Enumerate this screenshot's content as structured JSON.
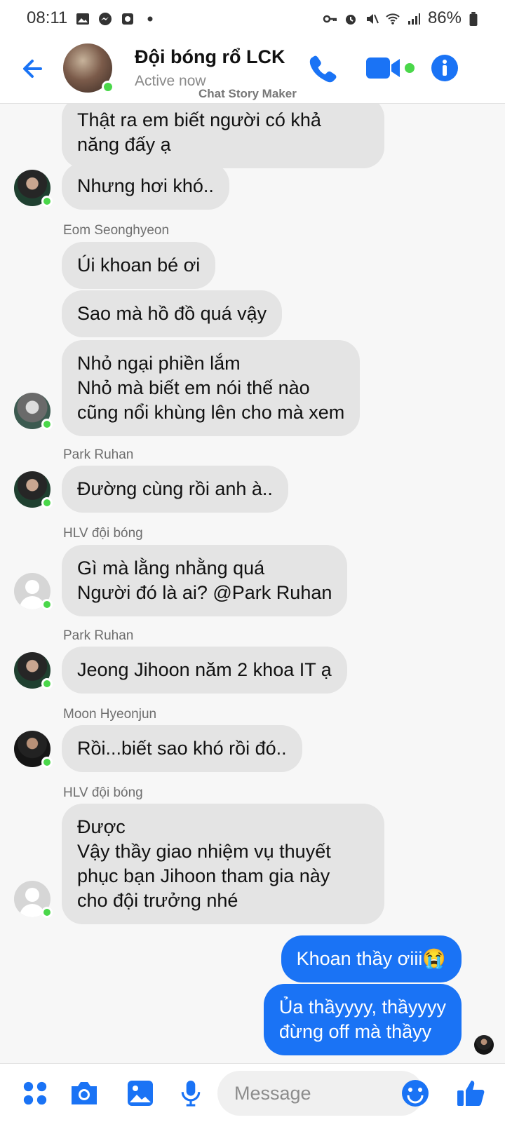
{
  "status_bar": {
    "time": "08:11",
    "battery": "86%"
  },
  "header": {
    "title": "Đội bóng rổ LCK",
    "subtitle": "Active now",
    "watermark": "Chat Story Maker"
  },
  "messages": [
    {
      "text": "Thật ra em biết người có khả\nnăng đấy ạ"
    },
    {
      "text": "Nhưng hơi khó.."
    },
    {
      "sender": "Eom Seonghyeon"
    },
    {
      "text": "Úi khoan bé ơi"
    },
    {
      "text": "Sao mà hồ đồ quá vậy"
    },
    {
      "text": "Nhỏ ngại phiền lắm\nNhỏ mà biết em nói thế nào\ncũng nổi khùng lên cho mà xem"
    },
    {
      "sender": "Park Ruhan"
    },
    {
      "text": "Đường cùng rồi anh à.."
    },
    {
      "sender": "HLV đội bóng"
    },
    {
      "text": "Gì mà lằng nhằng quá\nNgười đó là ai? @Park Ruhan"
    },
    {
      "sender": "Park Ruhan"
    },
    {
      "text": "Jeong Jihoon năm 2 khoa IT ạ"
    },
    {
      "sender": "Moon Hyeonjun"
    },
    {
      "text": "Rồi...biết sao khó rồi đó.."
    },
    {
      "sender": "HLV đội bóng"
    },
    {
      "text": "Được\nVậy thầy giao nhiệm vụ thuyết\nphục bạn Jihoon tham gia này\ncho đội trưởng nhé"
    },
    {
      "text": "Khoan thầy ơiii😭"
    },
    {
      "text": "Ủa thầyyyy, thầyyyy\nđừng off mà thầyy"
    }
  ],
  "composer": {
    "placeholder": "Message"
  },
  "colors": {
    "accent": "#1a73f5",
    "online": "#4ad74a",
    "bubble": "#e4e4e4"
  }
}
